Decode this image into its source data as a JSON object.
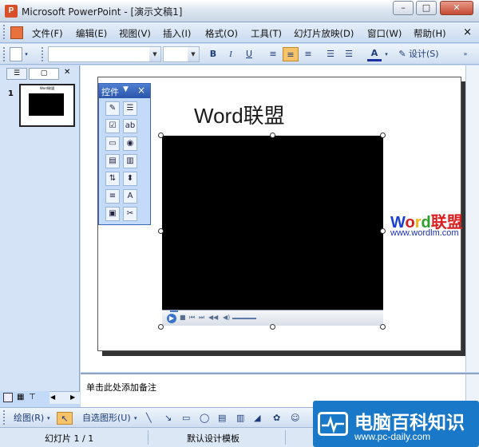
{
  "window": {
    "app_icon": "P",
    "title": "Microsoft PowerPoint - [演示文稿1]",
    "minimize": "–",
    "maximize": "□",
    "close": "✕"
  },
  "menu": {
    "items": [
      "文件(F)",
      "编辑(E)",
      "视图(V)",
      "插入(I)",
      "格式(O)",
      "工具(T)",
      "幻灯片放映(D)",
      "窗口(W)",
      "帮助(H)"
    ],
    "close": "×"
  },
  "toolbar": {
    "bold": "B",
    "italic": "I",
    "underline": "U",
    "font_color": "A",
    "design_label": "设计(S)"
  },
  "left_pane": {
    "tabs": [
      "☰",
      "▢",
      "✕"
    ],
    "slide_number": "1",
    "thumbnail_title": "Word联盟"
  },
  "slide": {
    "title": "Word联盟"
  },
  "control_toolbox": {
    "title": "控件",
    "close": "×",
    "icons": [
      "view-code-icon",
      "properties-icon",
      "checkbox-icon",
      "textbox-icon",
      "command-button-icon",
      "option-button-icon",
      "listbox-icon",
      "combobox-icon",
      "toggle-button-icon",
      "spinbutton-icon",
      "scrollbar-icon",
      "label-icon",
      "image-icon",
      "more-controls-icon"
    ],
    "glyphs": [
      "✎",
      "☰",
      "☑",
      "ab",
      "▭",
      "◉",
      "▤",
      "▥",
      "⇅",
      "⬍",
      "≡",
      "A",
      "▣",
      "✂"
    ]
  },
  "watermark": {
    "word_part": "Word",
    "lianmeng_part": "联盟",
    "url": "www.wordlm.com",
    "colors": {
      "W": "#1a3fd8",
      "o": "#d81f1f",
      "r": "#f2b019",
      "d": "#2aa02a",
      "lian": "#d81f1f"
    }
  },
  "notes": {
    "placeholder": "单击此处添加备注"
  },
  "drawing_toolbar": {
    "draw_label": "绘图(R)",
    "autoshapes_label": "自选图形(U)"
  },
  "status": {
    "slide_position": "幻灯片 1 / 1",
    "design_template": "默认设计模板"
  },
  "site_logo": {
    "name": "电脑百科知识",
    "url": "www.pc-daily.com"
  }
}
